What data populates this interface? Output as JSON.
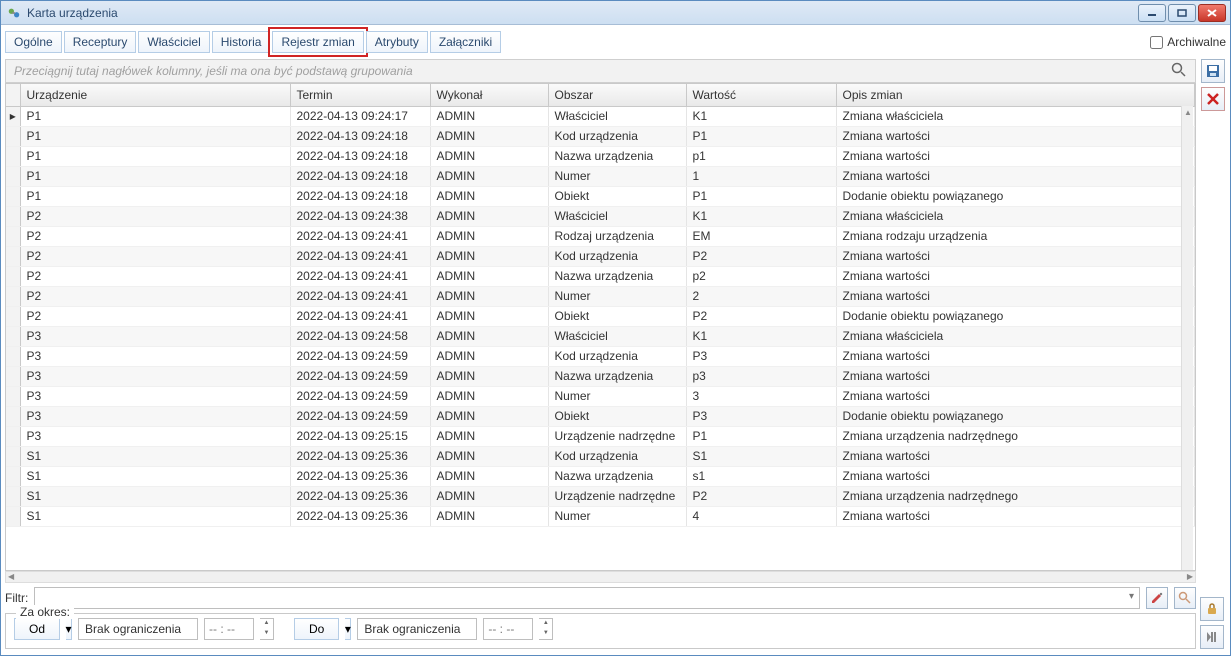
{
  "window": {
    "title": "Karta urządzenia"
  },
  "tabs": [
    {
      "label": "Ogólne"
    },
    {
      "label": "Receptury"
    },
    {
      "label": "Właściciel"
    },
    {
      "label": "Historia"
    },
    {
      "label": "Rejestr zmian",
      "active": true
    },
    {
      "label": "Atrybuty"
    },
    {
      "label": "Załączniki"
    }
  ],
  "archival_label": "Archiwalne",
  "group_hint": "Przeciągnij tutaj nagłówek kolumny, jeśli ma ona być podstawą grupowania",
  "columns": [
    {
      "label": "Urządzenie"
    },
    {
      "label": "Termin"
    },
    {
      "label": "Wykonał"
    },
    {
      "label": "Obszar"
    },
    {
      "label": "Wartość"
    },
    {
      "label": "Opis zmian"
    }
  ],
  "rows": [
    {
      "u": "P1",
      "t": "2022-04-13 09:24:17",
      "w": "ADMIN",
      "o": "Właściciel",
      "v": "K1",
      "d": "Zmiana właściciela"
    },
    {
      "u": "P1",
      "t": "2022-04-13 09:24:18",
      "w": "ADMIN",
      "o": "Kod urządzenia",
      "v": "P1",
      "d": "Zmiana wartości"
    },
    {
      "u": "P1",
      "t": "2022-04-13 09:24:18",
      "w": "ADMIN",
      "o": "Nazwa urządzenia",
      "v": "p1",
      "d": "Zmiana wartości"
    },
    {
      "u": "P1",
      "t": "2022-04-13 09:24:18",
      "w": "ADMIN",
      "o": "Numer",
      "v": "1",
      "d": "Zmiana wartości"
    },
    {
      "u": "P1",
      "t": "2022-04-13 09:24:18",
      "w": "ADMIN",
      "o": "Obiekt",
      "v": "P1",
      "d": "Dodanie obiektu powiązanego"
    },
    {
      "u": "P2",
      "t": "2022-04-13 09:24:38",
      "w": "ADMIN",
      "o": "Właściciel",
      "v": "K1",
      "d": "Zmiana właściciela"
    },
    {
      "u": "P2",
      "t": "2022-04-13 09:24:41",
      "w": "ADMIN",
      "o": "Rodzaj urządzenia",
      "v": "EM",
      "d": "Zmiana rodzaju urządzenia"
    },
    {
      "u": "P2",
      "t": "2022-04-13 09:24:41",
      "w": "ADMIN",
      "o": "Kod urządzenia",
      "v": "P2",
      "d": "Zmiana wartości"
    },
    {
      "u": "P2",
      "t": "2022-04-13 09:24:41",
      "w": "ADMIN",
      "o": "Nazwa urządzenia",
      "v": "p2",
      "d": "Zmiana wartości"
    },
    {
      "u": "P2",
      "t": "2022-04-13 09:24:41",
      "w": "ADMIN",
      "o": "Numer",
      "v": "2",
      "d": "Zmiana wartości"
    },
    {
      "u": "P2",
      "t": "2022-04-13 09:24:41",
      "w": "ADMIN",
      "o": "Obiekt",
      "v": "P2",
      "d": "Dodanie obiektu powiązanego"
    },
    {
      "u": "P3",
      "t": "2022-04-13 09:24:58",
      "w": "ADMIN",
      "o": "Właściciel",
      "v": "K1",
      "d": "Zmiana właściciela"
    },
    {
      "u": "P3",
      "t": "2022-04-13 09:24:59",
      "w": "ADMIN",
      "o": "Kod urządzenia",
      "v": "P3",
      "d": "Zmiana wartości"
    },
    {
      "u": "P3",
      "t": "2022-04-13 09:24:59",
      "w": "ADMIN",
      "o": "Nazwa urządzenia",
      "v": "p3",
      "d": "Zmiana wartości"
    },
    {
      "u": "P3",
      "t": "2022-04-13 09:24:59",
      "w": "ADMIN",
      "o": "Numer",
      "v": "3",
      "d": "Zmiana wartości"
    },
    {
      "u": "P3",
      "t": "2022-04-13 09:24:59",
      "w": "ADMIN",
      "o": "Obiekt",
      "v": "P3",
      "d": "Dodanie obiektu powiązanego"
    },
    {
      "u": "P3",
      "t": "2022-04-13 09:25:15",
      "w": "ADMIN",
      "o": "Urządzenie nadrzędne",
      "v": "P1",
      "d": "Zmiana urządzenia nadrzędnego"
    },
    {
      "u": "S1",
      "t": "2022-04-13 09:25:36",
      "w": "ADMIN",
      "o": "Kod urządzenia",
      "v": "S1",
      "d": "Zmiana wartości"
    },
    {
      "u": "S1",
      "t": "2022-04-13 09:25:36",
      "w": "ADMIN",
      "o": "Nazwa urządzenia",
      "v": "s1",
      "d": "Zmiana wartości"
    },
    {
      "u": "S1",
      "t": "2022-04-13 09:25:36",
      "w": "ADMIN",
      "o": "Urządzenie nadrzędne",
      "v": "P2",
      "d": "Zmiana urządzenia nadrzędnego"
    },
    {
      "u": "S1",
      "t": "2022-04-13 09:25:36",
      "w": "ADMIN",
      "o": "Numer",
      "v": "4",
      "d": "Zmiana wartości"
    }
  ],
  "filter_label": "Filtr:",
  "period": {
    "legend": "Za okres:",
    "from_label": "Od",
    "to_label": "Do",
    "from_value": "Brak ograniczenia",
    "to_value": "Brak ograniczenia",
    "time_placeholder": "-- : --"
  }
}
